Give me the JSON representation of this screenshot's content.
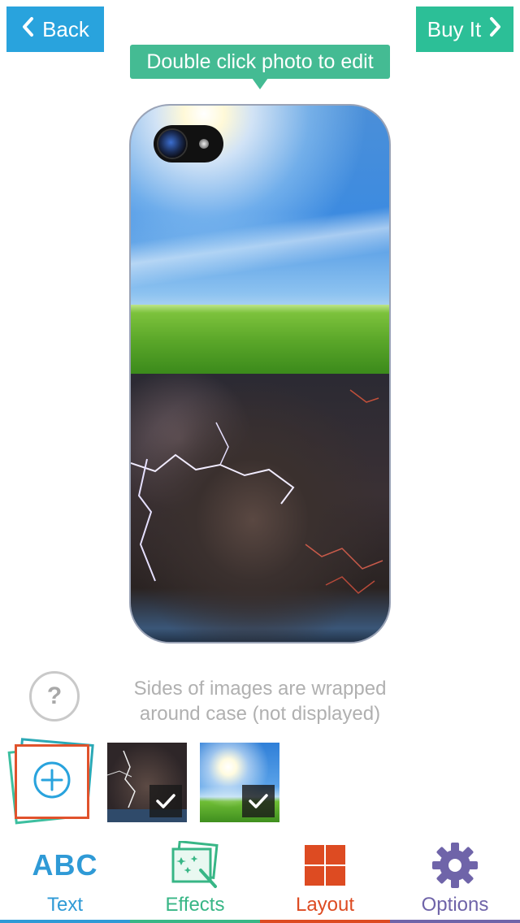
{
  "nav": {
    "back_label": "Back",
    "buy_label": "Buy It"
  },
  "tooltip": {
    "text": "Double click photo to edit"
  },
  "help": {
    "symbol": "?",
    "hint_line1": "Sides of images are wrapped",
    "hint_line2": "around case (not displayed)"
  },
  "thumbnails": [
    {
      "name": "storm-photo",
      "selected": true
    },
    {
      "name": "sky-photo",
      "selected": true
    }
  ],
  "tabs": [
    {
      "icon_text": "ABC",
      "label": "Text",
      "color": "#2f9ad6",
      "icon": "abc-text-icon"
    },
    {
      "label": "Effects",
      "color": "#38b686",
      "icon": "effects-icon"
    },
    {
      "label": "Layout",
      "color": "#dd4b22",
      "icon": "layout-grid-icon"
    },
    {
      "label": "Options",
      "color": "#6f64a9",
      "icon": "gear-icon"
    }
  ],
  "colors": {
    "back_button": "#29a3dd",
    "buy_button": "#2cbf97",
    "tooltip": "#44bb93",
    "add_border": "#e0522c"
  }
}
